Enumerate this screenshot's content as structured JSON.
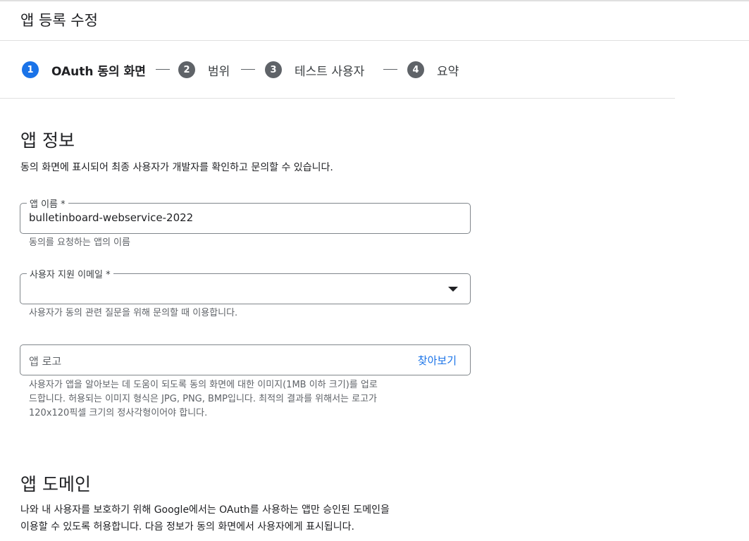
{
  "page": {
    "title": "앱 등록 수정"
  },
  "stepper": {
    "steps": [
      {
        "number": "1",
        "label": "OAuth 동의 화면"
      },
      {
        "number": "2",
        "label": "범위"
      },
      {
        "number": "3",
        "label": "테스트 사용자"
      },
      {
        "number": "4",
        "label": "요약"
      }
    ],
    "active_step": 1
  },
  "app_info": {
    "title": "앱 정보",
    "description": "동의 화면에 표시되어 최종 사용자가 개발자를 확인하고 문의할 수 있습니다.",
    "app_name": {
      "label": "앱 이름 *",
      "value": "bulletinboard-webservice-2022",
      "hint": "동의를 요청하는 앱의 이름"
    },
    "support_email": {
      "label": "사용자 지원 이메일 *",
      "value": "",
      "hint": "사용자가 동의 관련 질문을 위해 문의할 때 이용합니다."
    },
    "app_logo": {
      "placeholder": "앱 로고",
      "browse_label": "찾아보기",
      "hint_lines": [
        "사용자가 앱을 알아보는 데 도움이 되도록 동의 화면에 대한 이미지(1MB 이하 크기)를 업로",
        "드합니다. 허용되는 이미지 형식은 JPG, PNG, BMP입니다. 최적의 결과를 위해서는 로고가",
        "120x120픽셀 크기의 정사각형이어야 합니다."
      ]
    }
  },
  "app_domain": {
    "title": "앱 도메인",
    "description_lines": [
      "나와 내 사용자를 보호하기 위해 Google에서는 OAuth를 사용하는 앱만 승인된 도메인을",
      "이용할 수 있도록 허용합니다. 다음 정보가 동의 화면에서 사용자에게 표시됩니다."
    ]
  },
  "colors": {
    "accent": "#1a73e8",
    "inactive_step": "#5f6368",
    "border": "#80868b"
  }
}
